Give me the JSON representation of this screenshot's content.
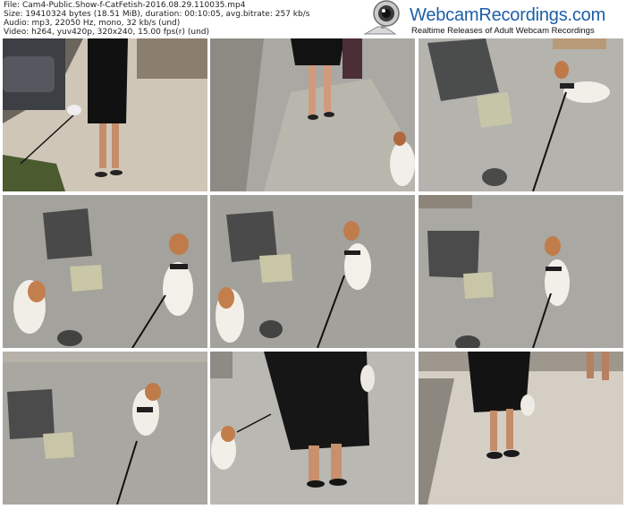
{
  "header": {
    "lines": [
      "File: Cam4-Public.Show-f-CatFetish-2016.08.29.110035.mp4",
      "Size: 19410324 bytes (18.51 MiB), duration: 00:10:05, avg.bitrate: 257 kb/s",
      "Audio: mp3, 22050 Hz, mono, 32 kb/s (und)",
      "Video: h264, yuv420p, 320x240, 15.00 fps(r) (und)"
    ]
  },
  "logo": {
    "title": "WebcamRecordings.com",
    "tagline": "Realtime Releases of Adult Webcam Recordings",
    "icon": "webcam-icon",
    "colors": {
      "title": "#1d5fa6",
      "tagline": "#111111"
    }
  },
  "frames": [
    {
      "scene": "woman-walking-dog-street"
    },
    {
      "scene": "legs-and-dog-pavement"
    },
    {
      "scene": "dog-on-leash-near-drain"
    },
    {
      "scene": "two-dogs-near-drain-cover"
    },
    {
      "scene": "two-dogs-near-drain-cover"
    },
    {
      "scene": "dog-on-leash-pavement"
    },
    {
      "scene": "dog-on-leash-pavement"
    },
    {
      "scene": "woman-black-dress-with-dog"
    },
    {
      "scene": "woman-walking-dog-street"
    }
  ]
}
